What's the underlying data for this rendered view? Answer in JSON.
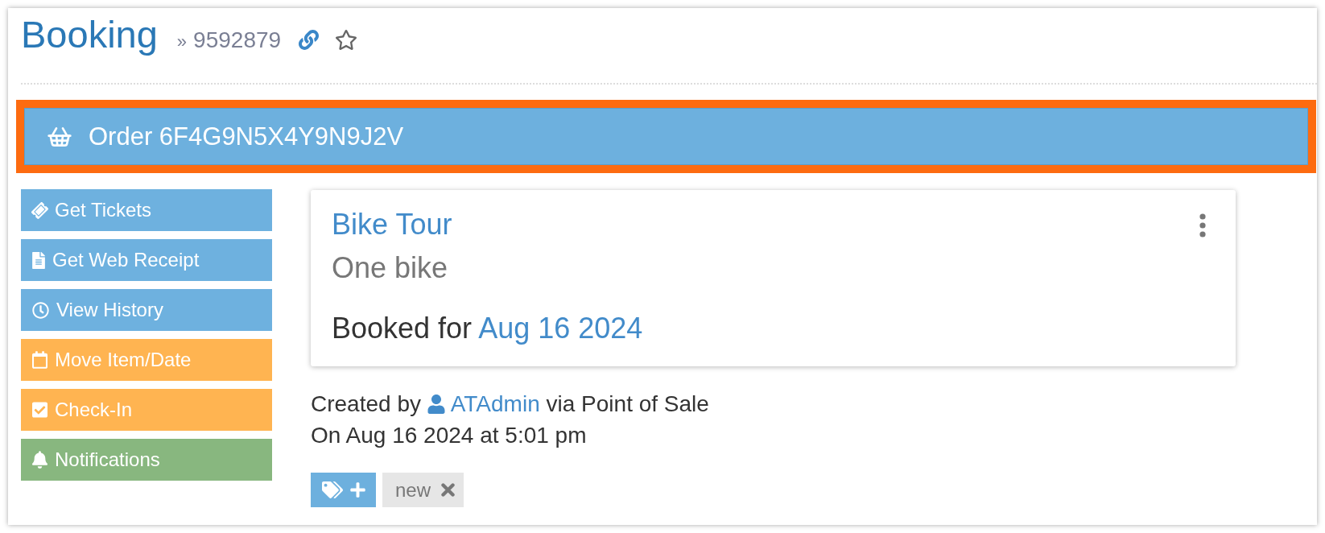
{
  "header": {
    "title": "Booking",
    "separator": "»",
    "booking_number": "9592879",
    "starred": false
  },
  "order": {
    "title": "Order 6F4G9N5X4Y9N9J2V",
    "highlighted": true
  },
  "actions": [
    {
      "label": "Get Tickets",
      "color": "#6eb1df"
    },
    {
      "label": "Get Web Receipt",
      "color": "#6eb1df"
    },
    {
      "label": "View History",
      "color": "#6eb1df"
    },
    {
      "label": "Move Item/Date",
      "color": "#ffb451"
    },
    {
      "label": "Check-In",
      "color": "#ffb451"
    },
    {
      "label": "Notifications",
      "color": "#88b77f"
    }
  ],
  "item": {
    "title": "Bike Tour",
    "description": "One bike",
    "booked_label": "Booked for",
    "booked_date": "Aug 16 2024"
  },
  "created": {
    "prefix": "Created by",
    "user": "ATAdmin",
    "suffix": "via Point of Sale",
    "date_line": "On Aug 16 2024 at 5:01 pm"
  },
  "tags": [
    {
      "label": "new"
    }
  ]
}
